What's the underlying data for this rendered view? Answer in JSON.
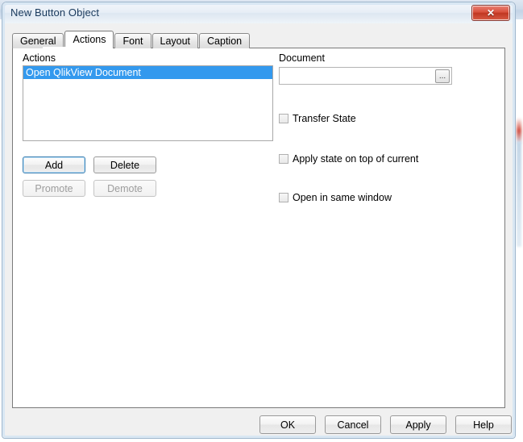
{
  "window": {
    "title": "New Button Object",
    "close_label": "✕",
    "close_icon": "close-icon"
  },
  "tabs": [
    {
      "label": "General",
      "active": false
    },
    {
      "label": "Actions",
      "active": true
    },
    {
      "label": "Font",
      "active": false
    },
    {
      "label": "Layout",
      "active": false
    },
    {
      "label": "Caption",
      "active": false
    }
  ],
  "actions_panel": {
    "label": "Actions",
    "items": [
      {
        "label": "Open QlikView Document",
        "selected": true
      }
    ],
    "buttons": [
      {
        "label": "Add",
        "state": "focused"
      },
      {
        "label": "Delete",
        "state": "normal"
      },
      {
        "label": "Promote",
        "state": "disabled"
      },
      {
        "label": "Demote",
        "state": "disabled"
      }
    ]
  },
  "document_panel": {
    "label": "Document",
    "input_value": "",
    "input_placeholder": "",
    "browse_label": "...",
    "checkboxes": [
      {
        "label": "Transfer State",
        "checked": false
      },
      {
        "label": "Apply state on top of current",
        "checked": false
      },
      {
        "label": "Open in same window",
        "checked": false
      }
    ]
  },
  "footer": {
    "buttons": [
      {
        "label": "OK"
      },
      {
        "label": "Cancel"
      },
      {
        "label": "Apply"
      },
      {
        "label": "Help"
      }
    ]
  },
  "colors": {
    "selection_blue": "#3399ee",
    "close_red": "#c03722",
    "dialog_face": "#f0f0f0",
    "panel_white": "#ffffff"
  }
}
